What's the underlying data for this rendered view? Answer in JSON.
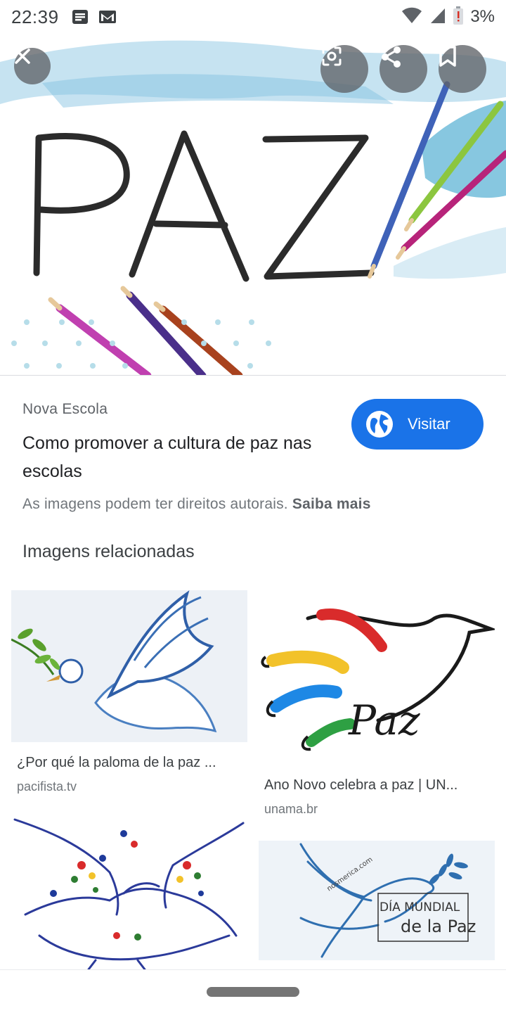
{
  "status_bar": {
    "time": "22:39",
    "left_icons": [
      "notes-icon",
      "gmail-icon"
    ],
    "right_icons": [
      "wifi-icon",
      "signal-icon",
      "battery-low-icon"
    ],
    "battery": "3%"
  },
  "hero": {
    "image_text": "PAZ",
    "actions": [
      "close-icon",
      "lens-search-icon",
      "share-icon",
      "bookmark-icon"
    ]
  },
  "result": {
    "source": "Nova Escola",
    "title": "Como promover a cultura de paz nas escolas",
    "visit_label": "Visitar",
    "copyright_text": "As imagens podem ter direitos autorais. ",
    "learn_more": "Saiba mais"
  },
  "related": {
    "heading": "Imagens relacionadas",
    "items": [
      {
        "title": "¿Por qué la paloma de la paz ...",
        "domain": "pacifista.tv"
      },
      {
        "title": "Ano Novo celebra a paz | UN...",
        "domain": "unama.br",
        "image_text": "Paz"
      },
      {
        "title": "",
        "domain": ""
      },
      {
        "title": "",
        "domain": "",
        "image_text_line1": "DÍA MUNDIAL",
        "image_text_line2": "de la Paz",
        "watermark": "nosmerica.com"
      }
    ]
  },
  "colors": {
    "accent": "#1a73e8",
    "text": "#202124",
    "muted": "#70757a"
  }
}
